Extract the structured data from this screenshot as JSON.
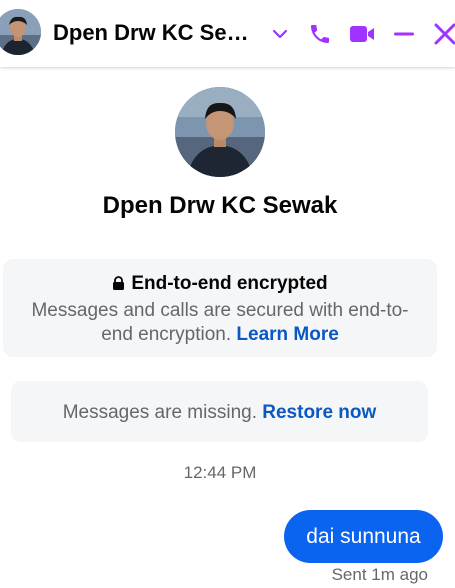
{
  "header": {
    "contact_name": "Dpen Drw KC Sewak",
    "contact_name_display": "Dpen Drw KC Se…",
    "icons": [
      "chevron-down-icon",
      "phone-icon",
      "video-camera-icon",
      "minimize-icon",
      "close-icon"
    ],
    "accent_color": "#a033ff"
  },
  "profile": {
    "name": "Dpen Drw KC Sewak"
  },
  "encryption_notice": {
    "title": "End-to-end encrypted",
    "description": "Messages and calls are secured with end-to-end encryption.",
    "link": "Learn More"
  },
  "missing_notice": {
    "text": "Messages are missing.",
    "link": "Restore now"
  },
  "conversation": {
    "timestamp": "12:44 PM",
    "messages": [
      {
        "direction": "outgoing",
        "text": "dai sunnuna",
        "status": "Sent 1m ago"
      }
    ]
  },
  "colors": {
    "link": "#0a58c2",
    "bubble": "#0a64f0",
    "card": "#f5f6f8",
    "muted_text": "#65676b"
  }
}
